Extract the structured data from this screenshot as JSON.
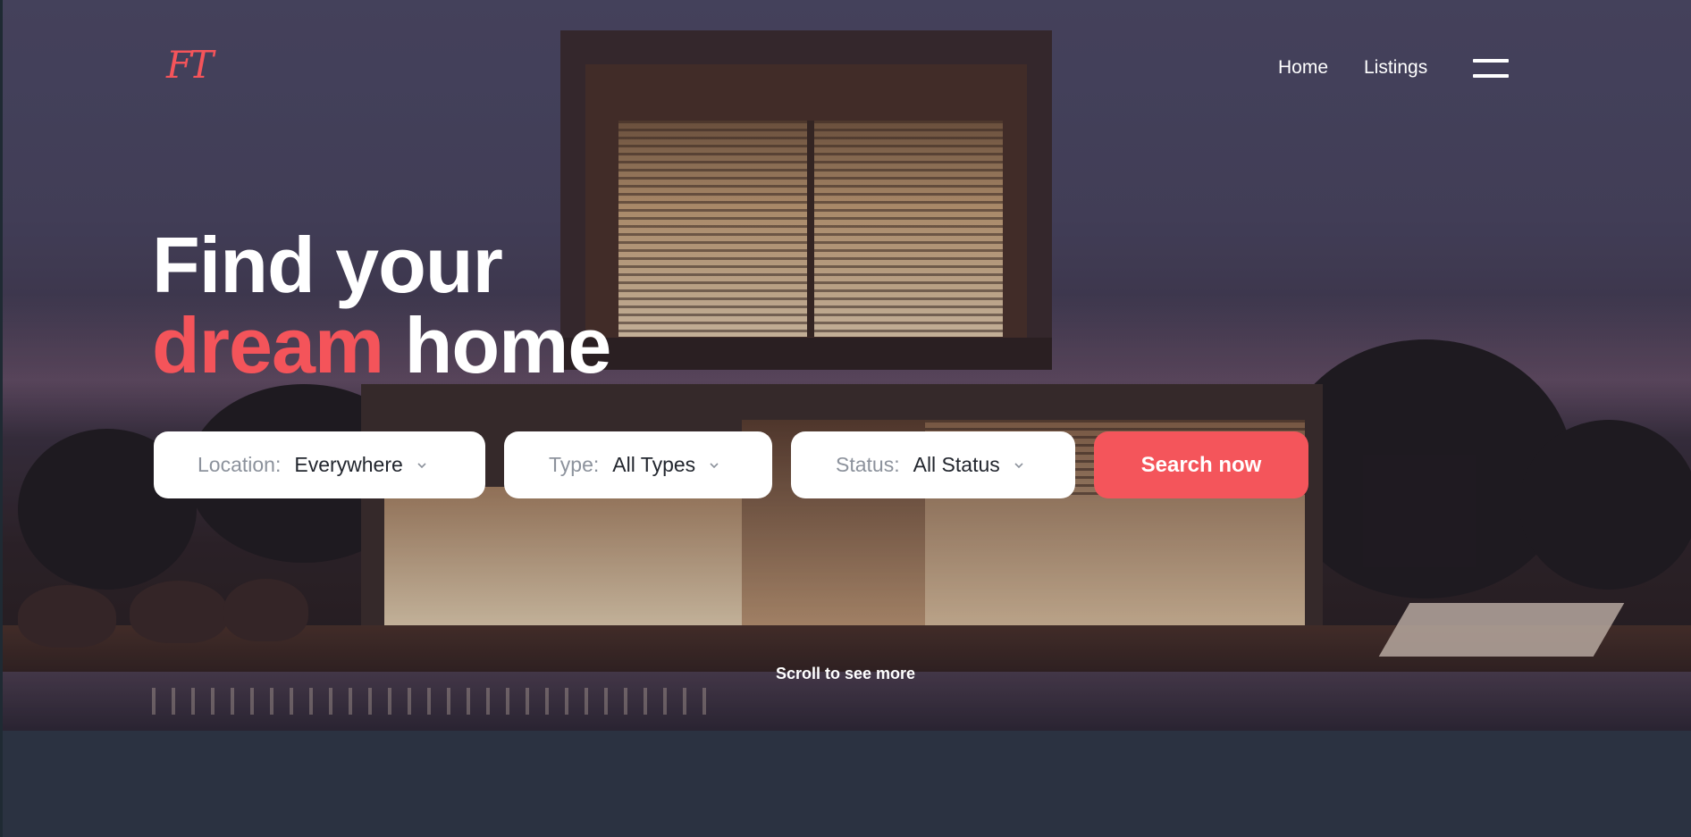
{
  "brand": {
    "logo_text": "FT"
  },
  "nav": {
    "links": [
      "Home",
      "Listings"
    ],
    "menu_icon": "hamburger-icon"
  },
  "hero": {
    "headline_line1": "Find your",
    "headline_accent": "dream",
    "headline_rest": "home",
    "scroll_hint": "Scroll to see more"
  },
  "search": {
    "location": {
      "label": "Location:",
      "value": "Everywhere"
    },
    "type": {
      "label": "Type:",
      "value": "All Types"
    },
    "status": {
      "label": "Status:",
      "value": "All Status"
    },
    "button_label": "Search now"
  },
  "colors": {
    "accent": "#f4545a",
    "footer_band": "#2b3241"
  }
}
